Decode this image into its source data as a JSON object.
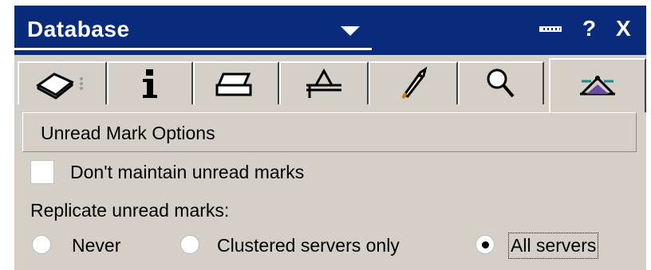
{
  "header": {
    "database_title": "Database",
    "dropdown_icon": "chevron-down-icon",
    "minimize_icon": "minimize-icon",
    "help_label": "?",
    "close_label": "X"
  },
  "tabs": [
    {
      "icon": "book-icon",
      "active": false
    },
    {
      "icon": "info-icon",
      "active": false
    },
    {
      "icon": "printer-icon",
      "active": false
    },
    {
      "icon": "design-icon",
      "active": false
    },
    {
      "icon": "rocket-icon",
      "active": false
    },
    {
      "icon": "search-icon",
      "active": false
    },
    {
      "icon": "advanced-icon",
      "active": true
    }
  ],
  "section": {
    "title": "Unread Mark Options",
    "dont_maintain_label": "Don't maintain unread marks",
    "dont_maintain_checked": false,
    "replicate_label": "Replicate unread marks:",
    "options": [
      {
        "label": "Never",
        "selected": false
      },
      {
        "label": "Clustered servers only",
        "selected": false
      },
      {
        "label": "All servers",
        "selected": true
      }
    ]
  }
}
